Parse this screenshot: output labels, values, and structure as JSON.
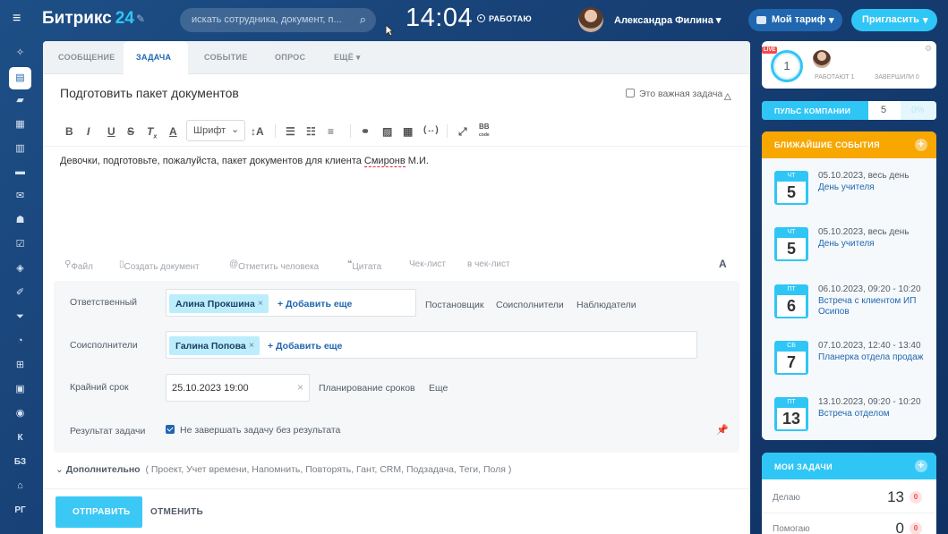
{
  "header": {
    "logo_text": "Битрикс",
    "logo_num": "24",
    "search_placeholder": "искать сотрудника, документ, п...",
    "clock": "14:04",
    "work_status": "РАБОТАЮ",
    "user_name": "Александра Филина",
    "tariff_label": "Мой тариф",
    "invite_label": "Пригласить",
    "accent": "#2fc6f6"
  },
  "sidebar": {
    "items": [
      "grid-icon",
      "chat-icon",
      "messages-icon",
      "calendar-icon",
      "documents-icon",
      "drive-icon",
      "mail-icon",
      "groups-icon",
      "tasks-icon",
      "crm-icon",
      "sign-icon",
      "filter-icon",
      "analytics-icon",
      "shop-icon",
      "contacts-icon",
      "robots-icon"
    ],
    "text_items": [
      "К",
      "БЗ",
      "РГ"
    ]
  },
  "tabs": [
    {
      "label": "СООБЩЕНИЕ"
    },
    {
      "label": "ЗАДАЧА",
      "active": true
    },
    {
      "label": "СОБЫТИЕ"
    },
    {
      "label": "ОПРОС"
    },
    {
      "label": "ЕЩЁ"
    }
  ],
  "task": {
    "title": "Подготовить пакет документов",
    "important_label": "Это важная задача",
    "font_select": "Шрифт",
    "body_text_before": "Девочки, подготовьте, пожалуйста, пакет документов для клиента ",
    "body_text_name": "Смиронв",
    "body_text_after": " М.И.",
    "attach": {
      "file": "Файл",
      "create_doc": "Создать документ",
      "mention": "Отметить человека",
      "quote": "Цитата",
      "checklist": "Чек-лист",
      "to_checklist": "в чек-лист",
      "text_format": "A"
    },
    "responsible_label": "Ответственный",
    "responsible_chip": "Алина Прокшина",
    "add_more": "+ Добавить еще",
    "role_links": [
      "Постановщик",
      "Соисполнители",
      "Наблюдатели"
    ],
    "coexec_label": "Соисполнители",
    "coexec_chip": "Галина Попова",
    "deadline_label": "Крайний срок",
    "deadline_value": "25.10.2023 19:00",
    "planning_link": "Планирование сроков",
    "more_link": "Еще",
    "result_label": "Результат задачи",
    "result_check": "Не завершать задачу без результата",
    "extra_label": "Дополнительно",
    "extra_items": "( Проект,  Учет времени,  Напомнить,  Повторять,  Гант,  CRM,  Подзадача,  Теги,  Поля )",
    "send": "ОТПРАВИТЬ",
    "cancel": "ОТМЕНИТЬ"
  },
  "live": {
    "tag": "LIVE",
    "count": "1",
    "working": "РАБОТАЮТ 1",
    "finished": "ЗАВЕРШИЛИ 0"
  },
  "pulse": {
    "label": "ПУЛЬС КОМПАНИИ",
    "value": "5",
    "percent": "0%"
  },
  "events": {
    "title": "БЛИЖАЙШИЕ СОБЫТИЯ",
    "items": [
      {
        "dow": "ЧТ",
        "day": "5",
        "date": "05.10.2023, весь день",
        "name": "День учителя"
      },
      {
        "dow": "ЧТ",
        "day": "5",
        "date": "05.10.2023, весь день",
        "name": "День учителя"
      },
      {
        "dow": "ПТ",
        "day": "6",
        "date": "06.10.2023, 09:20 - 10:20",
        "name": "Встреча с клиентом ИП Осипов"
      },
      {
        "dow": "СБ",
        "day": "7",
        "date": "07.10.2023, 12:40 - 13:40",
        "name": "Планерка отдела продаж"
      },
      {
        "dow": "ПТ",
        "day": "13",
        "date": "13.10.2023, 09:20 - 10:20",
        "name": "Встреча отделом"
      }
    ]
  },
  "my_tasks": {
    "title": "МОИ ЗАДАЧИ",
    "rows": [
      {
        "label": "Делаю",
        "count": "13",
        "badge": "0"
      },
      {
        "label": "Помогаю",
        "count": "0",
        "badge": "0"
      }
    ]
  }
}
